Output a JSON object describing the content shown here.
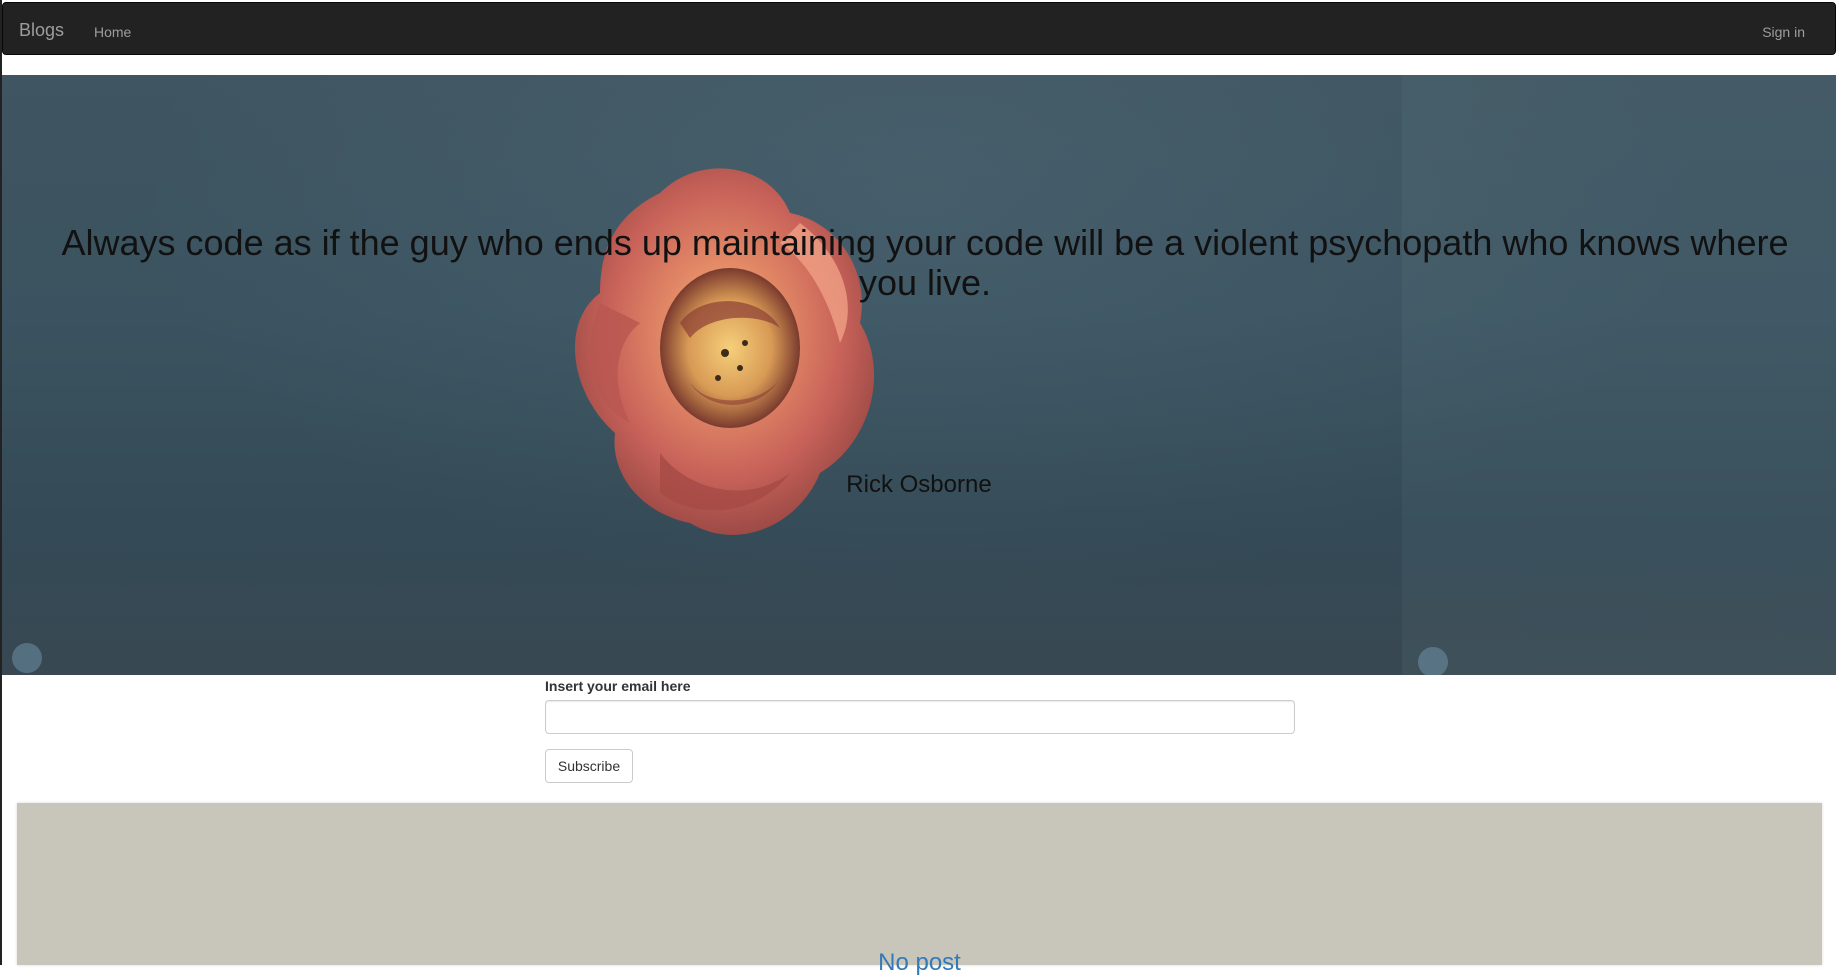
{
  "navbar": {
    "brand": "Blogs",
    "home": "Home",
    "sign_in": "Sign in"
  },
  "hero": {
    "quote": "Always code as if the guy who ends up maintaining your code will be a violent psychopath who knows where you live.",
    "author": "Rick Osborne"
  },
  "subscribe": {
    "label": "Insert your email here",
    "email_value": "",
    "button": "Subscribe"
  },
  "posts": {
    "empty_text": "No post"
  },
  "colors": {
    "navbar_bg": "#222222",
    "nav_text": "#9d9d9d",
    "hero_bg": "#3b5360",
    "panel_bg": "#c8c5bb",
    "link": "#337ab7"
  }
}
